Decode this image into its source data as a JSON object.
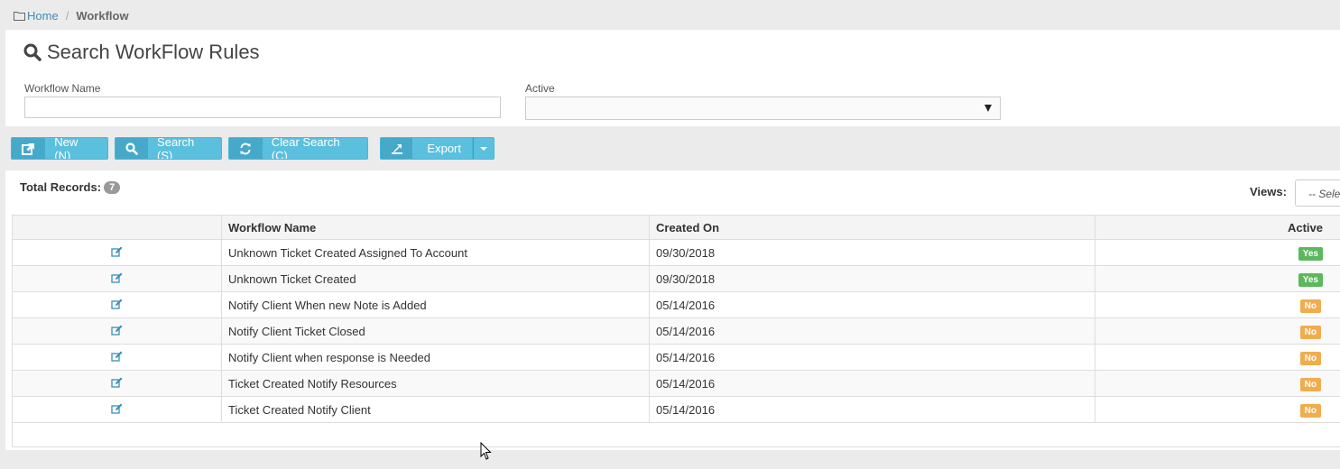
{
  "breadcrumb": {
    "home": "Home",
    "current": "Workflow"
  },
  "search": {
    "title": "Search WorkFlow Rules",
    "workflow_name_label": "Workflow Name",
    "workflow_name_value": "",
    "active_label": "Active",
    "active_value": ""
  },
  "toolbar": {
    "new_label": "New (N)",
    "search_label": "Search (S)",
    "clear_label": "Clear Search (C)",
    "export_label": "Export"
  },
  "results": {
    "total_label": "Total Records:",
    "total_count": "7",
    "views_label": "Views:",
    "views_placeholder": "-- Select --"
  },
  "table": {
    "headers": {
      "edit": "",
      "name": "Workflow Name",
      "created": "Created On",
      "active": "Active"
    },
    "rows": [
      {
        "name": "Unknown Ticket Created Assigned To Account",
        "created": "09/30/2018",
        "active": "Yes"
      },
      {
        "name": "Unknown Ticket Created",
        "created": "09/30/2018",
        "active": "Yes"
      },
      {
        "name": "Notify Client When new Note is Added",
        "created": "05/14/2016",
        "active": "No"
      },
      {
        "name": "Notify Client Ticket Closed",
        "created": "05/14/2016",
        "active": "No"
      },
      {
        "name": "Notify Client when response is Needed",
        "created": "05/14/2016",
        "active": "No"
      },
      {
        "name": "Ticket Created Notify Resources",
        "created": "05/14/2016",
        "active": "No"
      },
      {
        "name": "Ticket Created Notify Client",
        "created": "05/14/2016",
        "active": "No"
      }
    ]
  },
  "colors": {
    "accent": "#5bc0de",
    "yes": "#5cb85c",
    "no": "#f0ad4e",
    "link": "#3c8dbc"
  },
  "icons": {
    "home": "folder-icon",
    "search": "search-icon",
    "new": "external-link-icon",
    "clear": "refresh-icon",
    "export": "export-icon",
    "edit": "edit-icon"
  }
}
